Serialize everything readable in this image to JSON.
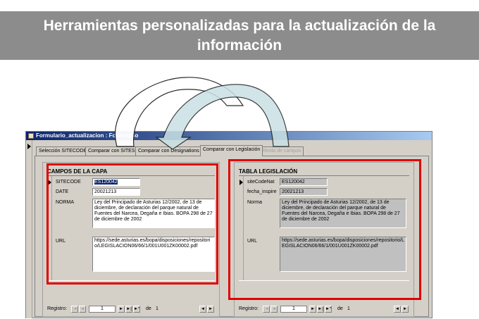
{
  "banner": {
    "line1": "Herramientas personalizadas para la actualización de la",
    "line2": "información"
  },
  "window": {
    "title": "Formulario_actualizacion : Formulario"
  },
  "tabs": [
    {
      "label": "Selección SITECODE",
      "state": "normal"
    },
    {
      "label": "Comparar con SITES",
      "state": "normal"
    },
    {
      "label": "Comparar con Designations",
      "state": "normal"
    },
    {
      "label": "Comparar con Legislación",
      "state": "active"
    },
    {
      "label": "Resto de campos",
      "state": "disabled"
    }
  ],
  "left_panel": {
    "title": "CAMPOS DE LA CAPA",
    "fields": {
      "sitecode": {
        "label": "SITECODE",
        "value": "ES120042"
      },
      "date": {
        "label": "DATE",
        "value": "20021213"
      },
      "norma": {
        "label": "NORMA",
        "value": "Ley del Principado de Asturias 12/2002, de 13 de diciembre, de declaración del parque natural de Fuentes del Narcea, Degaña e Ibias. BOPA 298 de 27 de diciembre de 2002"
      },
      "url": {
        "label": "URL",
        "value": "https://sede.asturias.es/bopa/disposiciones/repositorio/LEGISLACION06/66/1/001U001ZK00002.pdf"
      }
    },
    "navigation": {
      "label": "Registro:",
      "current": "1",
      "of_label": "de",
      "total": "1"
    }
  },
  "right_panel": {
    "title": "TABLA LEGISLACIÓN",
    "fields": {
      "sitecodenat": {
        "label": "siteCodeNat",
        "value": "ES120042"
      },
      "fecha": {
        "label": "fecha_inspire",
        "value": "20021213"
      },
      "norma": {
        "label": "Norma",
        "value": "Ley del Principado de Asturias 12/2002, de 13 de diciembre, de declaración del parque natural de Fuentes del Narcea, Degaña e Ibias. BOPA 298 de 27 de diciembre de 2002"
      },
      "url": {
        "label": "URL",
        "value": "https://sede.asturias.es/bopa/disposiciones/repositorio/LEGISLACION06/66/1/001U001ZK00002.pdf"
      }
    },
    "navigation": {
      "label": "Registro:",
      "current": "1",
      "of_label": "de",
      "total": "1"
    }
  },
  "nav_icons": {
    "first": "|◄",
    "prev": "◄",
    "next": "►",
    "last": "►|",
    "new": "►*",
    "scroll_left": "◄",
    "scroll_right": "►"
  },
  "colors": {
    "banner_bg": "#8c8c8c",
    "highlight": "#e00000",
    "window_bg": "#d4d0c8",
    "titlebar_start": "#0a246a"
  }
}
